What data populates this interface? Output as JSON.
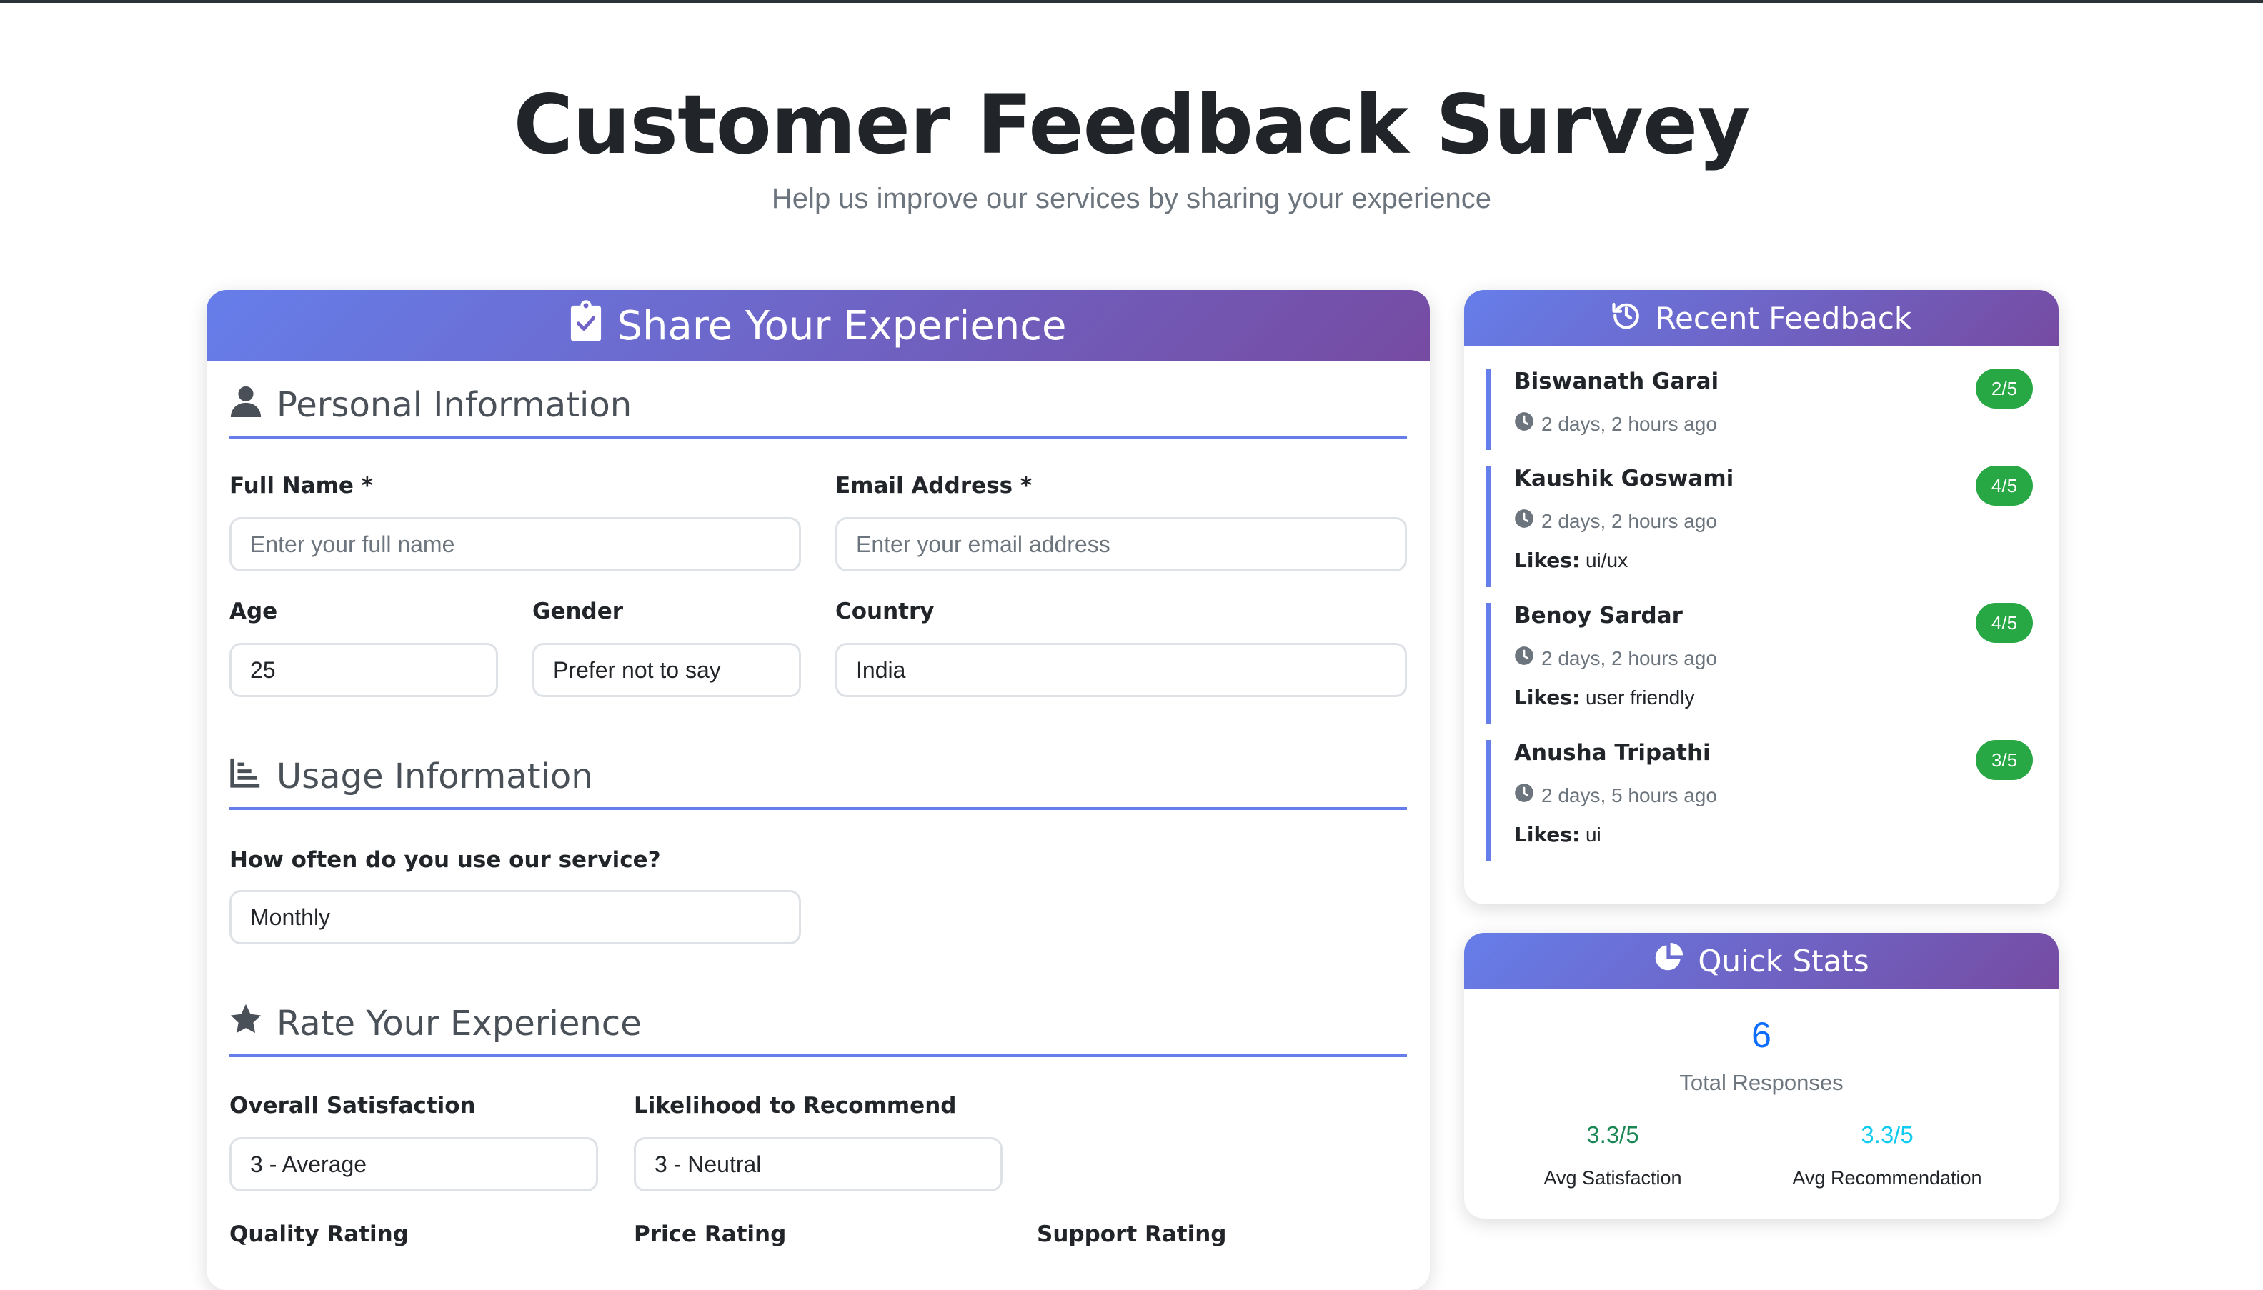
{
  "page": {
    "title": "Customer Feedback Survey",
    "subtitle": "Help us improve our services by sharing your experience"
  },
  "form": {
    "header_title": "Share Your Experience",
    "header_icon": "clipboard-check-icon",
    "sections": {
      "personal": {
        "title": "Personal Information",
        "icon": "user-icon"
      },
      "usage": {
        "title": "Usage Information",
        "icon": "chart-bar-icon"
      },
      "rate": {
        "title": "Rate Your Experience",
        "icon": "star-icon"
      }
    },
    "fields": {
      "full_name": {
        "label": "Full Name *",
        "placeholder": "Enter your full name",
        "value": ""
      },
      "email": {
        "label": "Email Address *",
        "placeholder": "Enter your email address",
        "value": ""
      },
      "age": {
        "label": "Age",
        "value": "25"
      },
      "gender": {
        "label": "Gender",
        "value": "Prefer not to say"
      },
      "country": {
        "label": "Country",
        "value": "India"
      },
      "usage_frequency": {
        "label": "How often do you use our service?",
        "value": "Monthly"
      },
      "overall_satisfaction": {
        "label": "Overall Satisfaction",
        "value": "3 - Average"
      },
      "recommend": {
        "label": "Likelihood to Recommend",
        "value": "3 - Neutral"
      },
      "quality_rating": {
        "label": "Quality Rating"
      },
      "price_rating": {
        "label": "Price Rating"
      },
      "support_rating": {
        "label": "Support Rating"
      }
    }
  },
  "recent_feedback": {
    "title": "Recent Feedback",
    "icon": "history-icon",
    "likes_label": "Likes:",
    "items": [
      {
        "name": "Biswanath Garai",
        "time": "2 days, 2 hours ago",
        "score": "2/5",
        "likes": ""
      },
      {
        "name": "Kaushik Goswami",
        "time": "2 days, 2 hours ago",
        "score": "4/5",
        "likes": "ui/ux"
      },
      {
        "name": "Benoy Sardar",
        "time": "2 days, 2 hours ago",
        "score": "4/5",
        "likes": "user friendly"
      },
      {
        "name": "Anusha Tripathi",
        "time": "2 days, 5 hours ago",
        "score": "3/5",
        "likes": "ui"
      }
    ]
  },
  "quick_stats": {
    "title": "Quick Stats",
    "icon": "pie-chart-icon",
    "total_value": "6",
    "total_label": "Total Responses",
    "avg_satisfaction_value": "3.3/5",
    "avg_satisfaction_label": "Avg Satisfaction",
    "avg_recommendation_value": "3.3/5",
    "avg_recommendation_label": "Avg Recommendation"
  },
  "colors": {
    "gradient_start": "#667eea",
    "gradient_end": "#764ba2",
    "badge_green": "#28a745",
    "stat_blue": "#0d6efd",
    "stat_green": "#198754",
    "stat_cyan": "#0dcaf0"
  }
}
